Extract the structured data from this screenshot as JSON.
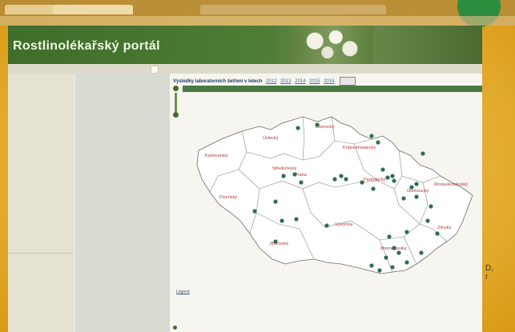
{
  "browser": {
    "tabs": [
      "",
      "",
      ""
    ]
  },
  "address_bar": {
    "text": "",
    "icons": ""
  },
  "header": {
    "breadcrumb": "",
    "title": "Rostlinolékařský portál",
    "subtitle": ""
  },
  "top_tabs": [
    "",
    "",
    "",
    "",
    ""
  ],
  "sidebar": {
    "items": [
      "",
      "",
      "",
      "",
      "",
      "",
      ""
    ]
  },
  "main": {
    "results_title": "Výsledky laboratorních šetření v letech",
    "years": [
      "2012",
      "2013",
      "2014",
      "2015",
      "2016"
    ],
    "map_bar_text": "",
    "legend_link": "Legend",
    "sub_title": "",
    "sub_lines": [
      "",
      ""
    ]
  },
  "map": {
    "regions": [
      {
        "name": "Karlovarský"
      },
      {
        "name": "Ústecký"
      },
      {
        "name": "Liberecký"
      },
      {
        "name": "Královéhradecký"
      },
      {
        "name": "Středočeský"
      },
      {
        "name": "Praha"
      },
      {
        "name": "Plzeňský"
      },
      {
        "name": "Pardubický"
      },
      {
        "name": "Jihočeský"
      },
      {
        "name": "Vysočina"
      },
      {
        "name": "Olomoucký"
      },
      {
        "name": "Moravskoslezský"
      },
      {
        "name": "Jihomoravský"
      },
      {
        "name": "Zlínský"
      }
    ],
    "dot_count": 40
  },
  "edge_text": "D,\nr"
}
